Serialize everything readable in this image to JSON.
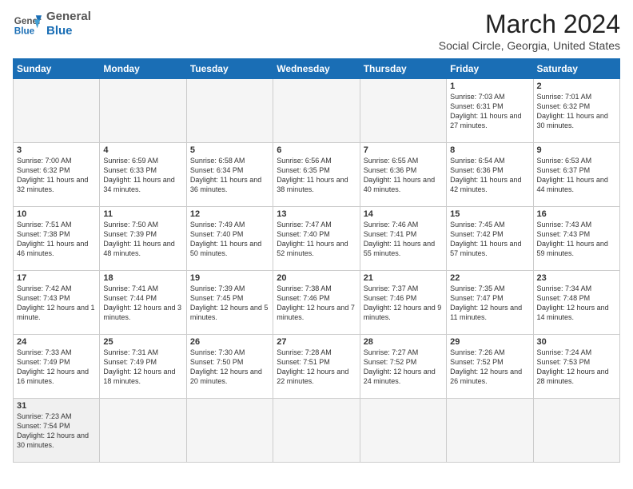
{
  "header": {
    "logo_line1": "General",
    "logo_line2": "Blue",
    "title": "March 2024",
    "subtitle": "Social Circle, Georgia, United States"
  },
  "days_of_week": [
    "Sunday",
    "Monday",
    "Tuesday",
    "Wednesday",
    "Thursday",
    "Friday",
    "Saturday"
  ],
  "weeks": [
    [
      {
        "num": "",
        "info": ""
      },
      {
        "num": "",
        "info": ""
      },
      {
        "num": "",
        "info": ""
      },
      {
        "num": "",
        "info": ""
      },
      {
        "num": "",
        "info": ""
      },
      {
        "num": "1",
        "info": "Sunrise: 7:03 AM\nSunset: 6:31 PM\nDaylight: 11 hours and 27 minutes."
      },
      {
        "num": "2",
        "info": "Sunrise: 7:01 AM\nSunset: 6:32 PM\nDaylight: 11 hours and 30 minutes."
      }
    ],
    [
      {
        "num": "3",
        "info": "Sunrise: 7:00 AM\nSunset: 6:32 PM\nDaylight: 11 hours and 32 minutes."
      },
      {
        "num": "4",
        "info": "Sunrise: 6:59 AM\nSunset: 6:33 PM\nDaylight: 11 hours and 34 minutes."
      },
      {
        "num": "5",
        "info": "Sunrise: 6:58 AM\nSunset: 6:34 PM\nDaylight: 11 hours and 36 minutes."
      },
      {
        "num": "6",
        "info": "Sunrise: 6:56 AM\nSunset: 6:35 PM\nDaylight: 11 hours and 38 minutes."
      },
      {
        "num": "7",
        "info": "Sunrise: 6:55 AM\nSunset: 6:36 PM\nDaylight: 11 hours and 40 minutes."
      },
      {
        "num": "8",
        "info": "Sunrise: 6:54 AM\nSunset: 6:36 PM\nDaylight: 11 hours and 42 minutes."
      },
      {
        "num": "9",
        "info": "Sunrise: 6:53 AM\nSunset: 6:37 PM\nDaylight: 11 hours and 44 minutes."
      }
    ],
    [
      {
        "num": "10",
        "info": "Sunrise: 7:51 AM\nSunset: 7:38 PM\nDaylight: 11 hours and 46 minutes."
      },
      {
        "num": "11",
        "info": "Sunrise: 7:50 AM\nSunset: 7:39 PM\nDaylight: 11 hours and 48 minutes."
      },
      {
        "num": "12",
        "info": "Sunrise: 7:49 AM\nSunset: 7:40 PM\nDaylight: 11 hours and 50 minutes."
      },
      {
        "num": "13",
        "info": "Sunrise: 7:47 AM\nSunset: 7:40 PM\nDaylight: 11 hours and 52 minutes."
      },
      {
        "num": "14",
        "info": "Sunrise: 7:46 AM\nSunset: 7:41 PM\nDaylight: 11 hours and 55 minutes."
      },
      {
        "num": "15",
        "info": "Sunrise: 7:45 AM\nSunset: 7:42 PM\nDaylight: 11 hours and 57 minutes."
      },
      {
        "num": "16",
        "info": "Sunrise: 7:43 AM\nSunset: 7:43 PM\nDaylight: 11 hours and 59 minutes."
      }
    ],
    [
      {
        "num": "17",
        "info": "Sunrise: 7:42 AM\nSunset: 7:43 PM\nDaylight: 12 hours and 1 minute."
      },
      {
        "num": "18",
        "info": "Sunrise: 7:41 AM\nSunset: 7:44 PM\nDaylight: 12 hours and 3 minutes."
      },
      {
        "num": "19",
        "info": "Sunrise: 7:39 AM\nSunset: 7:45 PM\nDaylight: 12 hours and 5 minutes."
      },
      {
        "num": "20",
        "info": "Sunrise: 7:38 AM\nSunset: 7:46 PM\nDaylight: 12 hours and 7 minutes."
      },
      {
        "num": "21",
        "info": "Sunrise: 7:37 AM\nSunset: 7:46 PM\nDaylight: 12 hours and 9 minutes."
      },
      {
        "num": "22",
        "info": "Sunrise: 7:35 AM\nSunset: 7:47 PM\nDaylight: 12 hours and 11 minutes."
      },
      {
        "num": "23",
        "info": "Sunrise: 7:34 AM\nSunset: 7:48 PM\nDaylight: 12 hours and 14 minutes."
      }
    ],
    [
      {
        "num": "24",
        "info": "Sunrise: 7:33 AM\nSunset: 7:49 PM\nDaylight: 12 hours and 16 minutes."
      },
      {
        "num": "25",
        "info": "Sunrise: 7:31 AM\nSunset: 7:49 PM\nDaylight: 12 hours and 18 minutes."
      },
      {
        "num": "26",
        "info": "Sunrise: 7:30 AM\nSunset: 7:50 PM\nDaylight: 12 hours and 20 minutes."
      },
      {
        "num": "27",
        "info": "Sunrise: 7:28 AM\nSunset: 7:51 PM\nDaylight: 12 hours and 22 minutes."
      },
      {
        "num": "28",
        "info": "Sunrise: 7:27 AM\nSunset: 7:52 PM\nDaylight: 12 hours and 24 minutes."
      },
      {
        "num": "29",
        "info": "Sunrise: 7:26 AM\nSunset: 7:52 PM\nDaylight: 12 hours and 26 minutes."
      },
      {
        "num": "30",
        "info": "Sunrise: 7:24 AM\nSunset: 7:53 PM\nDaylight: 12 hours and 28 minutes."
      }
    ],
    [
      {
        "num": "31",
        "info": "Sunrise: 7:23 AM\nSunset: 7:54 PM\nDaylight: 12 hours and 30 minutes."
      },
      {
        "num": "",
        "info": ""
      },
      {
        "num": "",
        "info": ""
      },
      {
        "num": "",
        "info": ""
      },
      {
        "num": "",
        "info": ""
      },
      {
        "num": "",
        "info": ""
      },
      {
        "num": "",
        "info": ""
      }
    ]
  ]
}
